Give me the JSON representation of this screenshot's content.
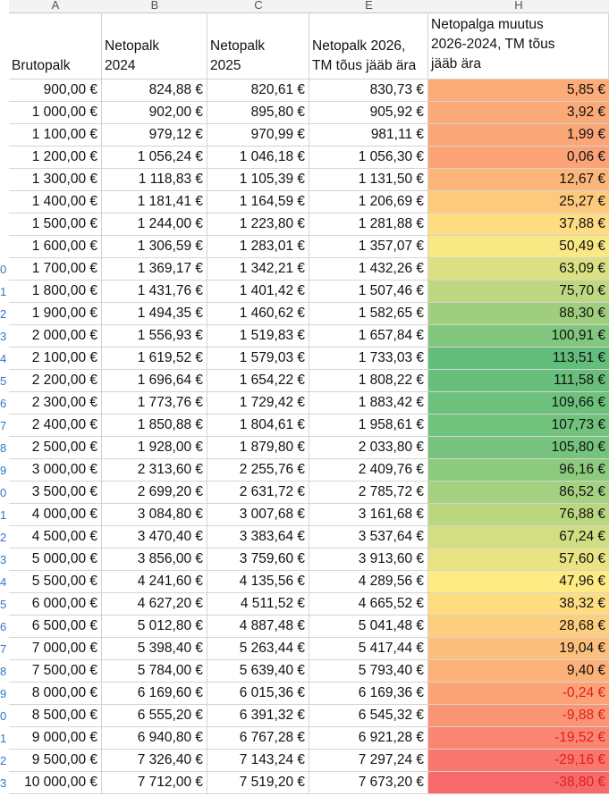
{
  "column_letters": [
    "A",
    "B",
    "C",
    "E",
    "H"
  ],
  "headers": [
    "Brutopalk",
    "Netopalk\n2024",
    "Netopalk\n2025",
    "Netopalk 2026,\nTM tõus jääb ära",
    "Netopalga muutus\n2026-2024, TM tõus\njääb ära"
  ],
  "row_numbers": [
    "",
    "",
    "",
    "",
    "",
    "",
    "",
    "",
    "0",
    "1",
    "2",
    "3",
    "4",
    "5",
    "6",
    "7",
    "8",
    "9",
    "0",
    "1",
    "2",
    "3",
    "4",
    "5",
    "6",
    "7",
    "8",
    "9",
    "0",
    "1",
    "2",
    "3"
  ],
  "rows": [
    [
      "900,00 €",
      "824,88 €",
      "820,61 €",
      "830,73 €",
      "5,85 €"
    ],
    [
      "1 000,00 €",
      "902,00 €",
      "895,80 €",
      "905,92 €",
      "3,92 €"
    ],
    [
      "1 100,00 €",
      "979,12 €",
      "970,99 €",
      "981,11 €",
      "1,99 €"
    ],
    [
      "1 200,00 €",
      "1 056,24 €",
      "1 046,18 €",
      "1 056,30 €",
      "0,06 €"
    ],
    [
      "1 300,00 €",
      "1 118,83 €",
      "1 105,39 €",
      "1 131,50 €",
      "12,67 €"
    ],
    [
      "1 400,00 €",
      "1 181,41 €",
      "1 164,59 €",
      "1 206,69 €",
      "25,27 €"
    ],
    [
      "1 500,00 €",
      "1 244,00 €",
      "1 223,80 €",
      "1 281,88 €",
      "37,88 €"
    ],
    [
      "1 600,00 €",
      "1 306,59 €",
      "1 283,01 €",
      "1 357,07 €",
      "50,49 €"
    ],
    [
      "1 700,00 €",
      "1 369,17 €",
      "1 342,21 €",
      "1 432,26 €",
      "63,09 €"
    ],
    [
      "1 800,00 €",
      "1 431,76 €",
      "1 401,42 €",
      "1 507,46 €",
      "75,70 €"
    ],
    [
      "1 900,00 €",
      "1 494,35 €",
      "1 460,62 €",
      "1 582,65 €",
      "88,30 €"
    ],
    [
      "2 000,00 €",
      "1 556,93 €",
      "1 519,83 €",
      "1 657,84 €",
      "100,91 €"
    ],
    [
      "2 100,00 €",
      "1 619,52 €",
      "1 579,03 €",
      "1 733,03 €",
      "113,51 €"
    ],
    [
      "2 200,00 €",
      "1 696,64 €",
      "1 654,22 €",
      "1 808,22 €",
      "111,58 €"
    ],
    [
      "2 300,00 €",
      "1 773,76 €",
      "1 729,42 €",
      "1 883,42 €",
      "109,66 €"
    ],
    [
      "2 400,00 €",
      "1 850,88 €",
      "1 804,61 €",
      "1 958,61 €",
      "107,73 €"
    ],
    [
      "2 500,00 €",
      "1 928,00 €",
      "1 879,80 €",
      "2 033,80 €",
      "105,80 €"
    ],
    [
      "3 000,00 €",
      "2 313,60 €",
      "2 255,76 €",
      "2 409,76 €",
      "96,16 €"
    ],
    [
      "3 500,00 €",
      "2 699,20 €",
      "2 631,72 €",
      "2 785,72 €",
      "86,52 €"
    ],
    [
      "4 000,00 €",
      "3 084,80 €",
      "3 007,68 €",
      "3 161,68 €",
      "76,88 €"
    ],
    [
      "4 500,00 €",
      "3 470,40 €",
      "3 383,64 €",
      "3 537,64 €",
      "67,24 €"
    ],
    [
      "5 000,00 €",
      "3 856,00 €",
      "3 759,60 €",
      "3 913,60 €",
      "57,60 €"
    ],
    [
      "5 500,00 €",
      "4 241,60 €",
      "4 135,56 €",
      "4 289,56 €",
      "47,96 €"
    ],
    [
      "6 000,00 €",
      "4 627,20 €",
      "4 511,52 €",
      "4 665,52 €",
      "38,32 €"
    ],
    [
      "6 500,00 €",
      "5 012,80 €",
      "4 887,48 €",
      "5 041,48 €",
      "28,68 €"
    ],
    [
      "7 000,00 €",
      "5 398,40 €",
      "5 263,44 €",
      "5 417,44 €",
      "19,04 €"
    ],
    [
      "7 500,00 €",
      "5 784,00 €",
      "5 639,40 €",
      "5 793,40 €",
      "9,40 €"
    ],
    [
      "8 000,00 €",
      "6 169,60 €",
      "6 015,36 €",
      "6 169,36 €",
      "-0,24 €"
    ],
    [
      "8 500,00 €",
      "6 555,20 €",
      "6 391,32 €",
      "6 545,32 €",
      "-9,88 €"
    ],
    [
      "9 000,00 €",
      "6 940,80 €",
      "6 767,28 €",
      "6 921,28 €",
      "-19,52 €"
    ],
    [
      "9 500,00 €",
      "7 326,40 €",
      "7 143,24 €",
      "7 297,24 €",
      "-29,16 €"
    ],
    [
      "10 000,00 €",
      "7 712,00 €",
      "7 519,20 €",
      "7 673,20 €",
      "-38,80 €"
    ]
  ],
  "color_scale": {
    "min": "#f8696b",
    "mid": "#ffeb84",
    "max": "#63be7b"
  },
  "negative_text_color": "#e0201e"
}
